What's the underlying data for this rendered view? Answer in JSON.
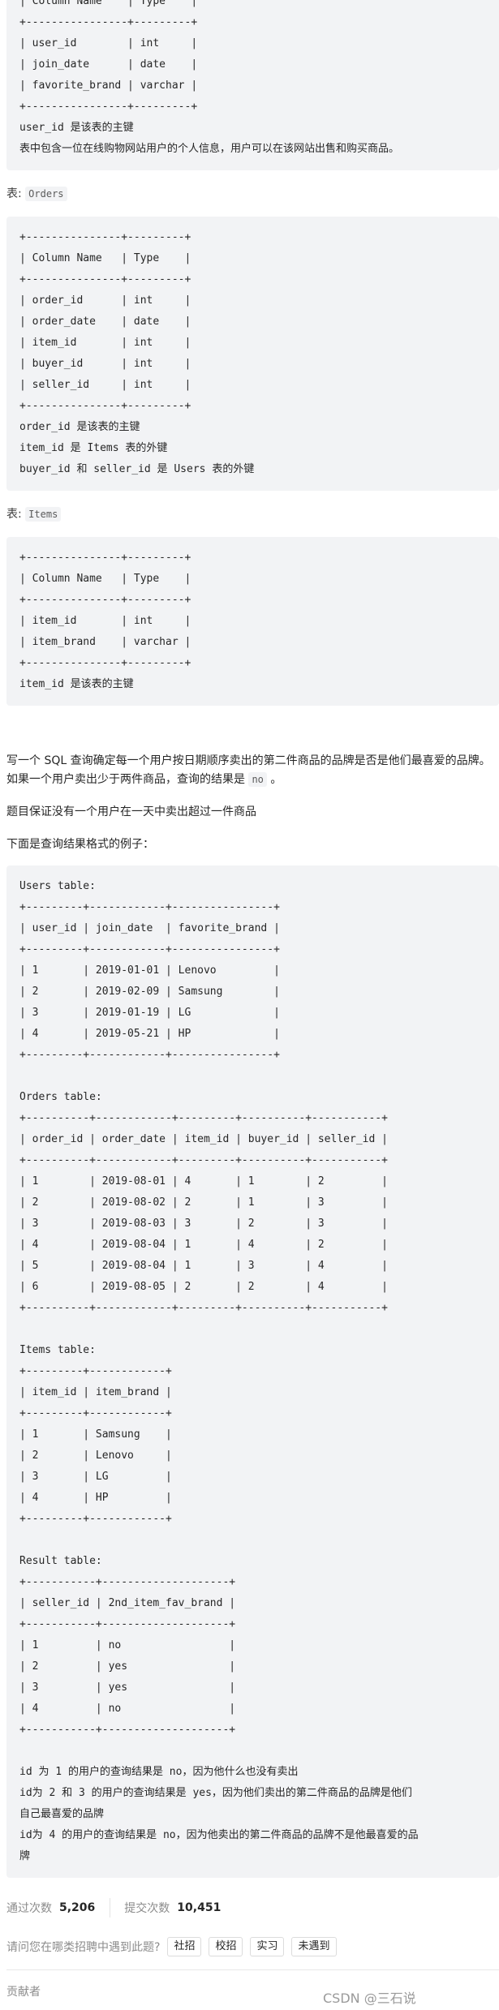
{
  "schema_blocks": [
    {
      "lines": [
        "+----------------+---------+",
        "| Column Name    | Type    |",
        "+----------------+---------+",
        "| user_id        | int     |",
        "| join_date      | date    |",
        "| favorite_brand | varchar |",
        "+----------------+---------+",
        "user_id 是该表的主键",
        "表中包含一位在线购物网站用户的个人信息，用户可以在该网站出售和购买商品。"
      ]
    },
    {
      "label_prefix": "表: ",
      "label_code": "Orders",
      "lines": [
        "+---------------+---------+",
        "| Column Name   | Type    |",
        "+---------------+---------+",
        "| order_id      | int     |",
        "| order_date    | date    |",
        "| item_id       | int     |",
        "| buyer_id      | int     |",
        "| seller_id     | int     |",
        "+---------------+---------+",
        "order_id 是该表的主键",
        "item_id 是 Items 表的外键",
        "buyer_id 和 seller_id 是 Users 表的外键"
      ]
    },
    {
      "label_prefix": "表: ",
      "label_code": "Items",
      "lines": [
        "+---------------+---------+",
        "| Column Name   | Type    |",
        "+---------------+---------+",
        "| item_id       | int     |",
        "| item_brand    | varchar |",
        "+---------------+---------+",
        "item_id 是该表的主键"
      ]
    }
  ],
  "description": {
    "p1_text": "写一个 SQL 查询确定每一个用户按日期顺序卖出的第二件商品的品牌是否是他们最喜爱的品牌。如果一个用户卖出少于两件商品，查询的结果是 ",
    "p1_code": "no",
    "p1_end": " 。",
    "p2": "题目保证没有一个用户在一天中卖出超过一件商品",
    "p3": "下面是查询结果格式的例子："
  },
  "example": {
    "lines": [
      "Users table:",
      "+---------+------------+----------------+",
      "| user_id | join_date  | favorite_brand |",
      "+---------+------------+----------------+",
      "| 1       | 2019-01-01 | Lenovo         |",
      "| 2       | 2019-02-09 | Samsung        |",
      "| 3       | 2019-01-19 | LG             |",
      "| 4       | 2019-05-21 | HP             |",
      "+---------+------------+----------------+",
      "",
      "Orders table:",
      "+----------+------------+---------+----------+-----------+",
      "| order_id | order_date | item_id | buyer_id | seller_id |",
      "+----------+------------+---------+----------+-----------+",
      "| 1        | 2019-08-01 | 4       | 1        | 2         |",
      "| 2        | 2019-08-02 | 2       | 1        | 3         |",
      "| 3        | 2019-08-03 | 3       | 2        | 3         |",
      "| 4        | 2019-08-04 | 1       | 4        | 2         |",
      "| 5        | 2019-08-04 | 1       | 3        | 4         |",
      "| 6        | 2019-08-05 | 2       | 2        | 4         |",
      "+----------+------------+---------+----------+-----------+",
      "",
      "Items table:",
      "+---------+------------+",
      "| item_id | item_brand |",
      "+---------+------------+",
      "| 1       | Samsung    |",
      "| 2       | Lenovo     |",
      "| 3       | LG         |",
      "| 4       | HP         |",
      "+---------+------------+",
      "",
      "Result table:",
      "+-----------+--------------------+",
      "| seller_id | 2nd_item_fav_brand |",
      "+-----------+--------------------+",
      "| 1         | no                 |",
      "| 2         | yes                |",
      "| 3         | yes                |",
      "| 4         | no                 |",
      "+-----------+--------------------+",
      ""
    ],
    "explanations": [
      "id 为 1 的用户的查询结果是 no，因为他什么也没有卖出",
      "id为 2 和 3 的用户的查询结果是 yes，因为他们卖出的第二件商品的品牌是他们自己最喜爱的品牌",
      "id为 4 的用户的查询结果是 no，因为他卖出的第二件商品的品牌不是他最喜爱的品牌"
    ]
  },
  "stats": {
    "accepted_label": "通过次数",
    "accepted_value": "5,206",
    "submitted_label": "提交次数",
    "submitted_value": "10,451"
  },
  "survey": {
    "question": "请问您在哪类招聘中遇到此题?",
    "options": [
      "社招",
      "校招",
      "实习",
      "未遇到"
    ]
  },
  "contributors_label": "贡献者",
  "watermark": "CSDN @三石说"
}
